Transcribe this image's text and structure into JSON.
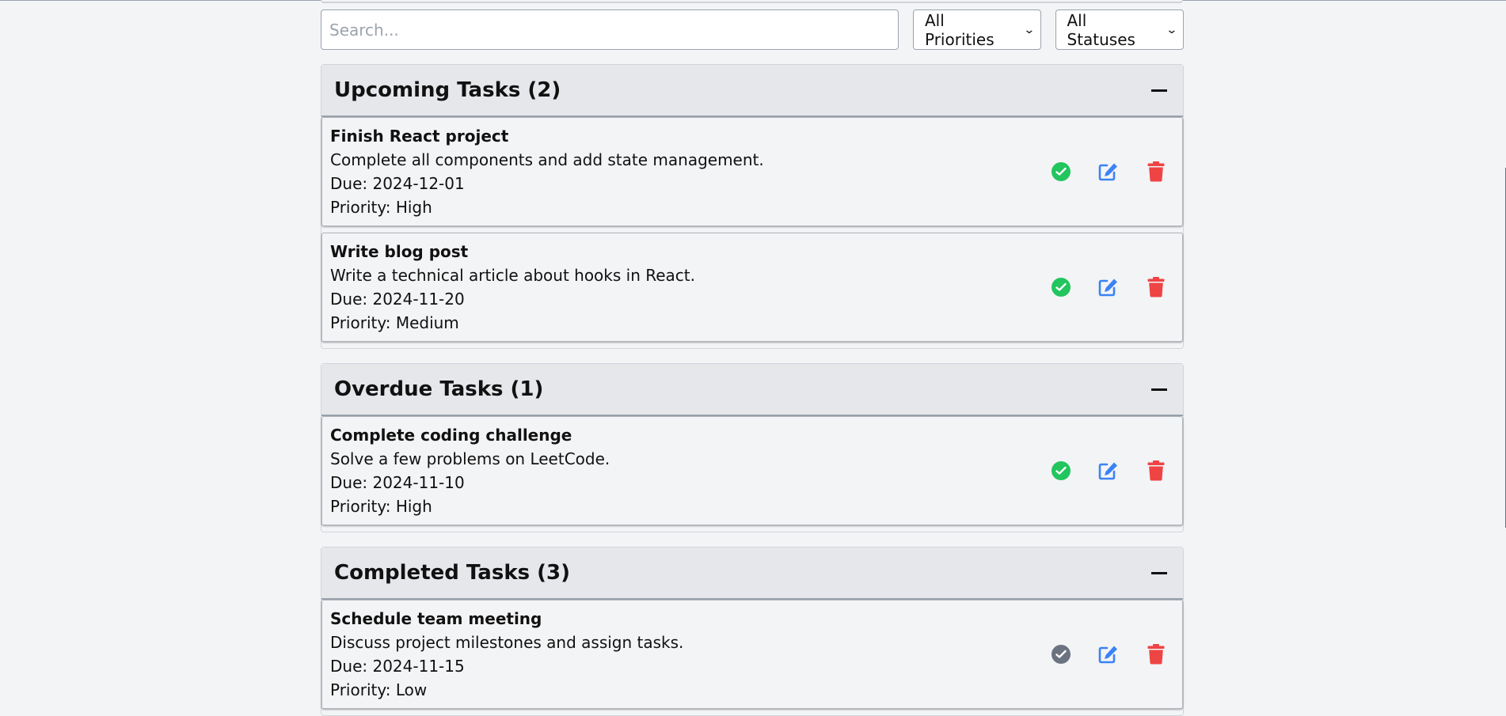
{
  "filters": {
    "search_placeholder": "Search...",
    "priority_selected": "All Priorities",
    "status_selected": "All Statuses"
  },
  "colors": {
    "complete_active": "#22c55e",
    "complete_done": "#6b7280",
    "edit": "#3b82f6",
    "delete": "#ef4444"
  },
  "sections": {
    "upcoming": {
      "title": "Upcoming Tasks (2)",
      "tasks": [
        {
          "title": "Finish React project",
          "description": "Complete all components and add state management.",
          "due": "Due: 2024-12-01",
          "priority": "Priority: High"
        },
        {
          "title": "Write blog post",
          "description": "Write a technical article about hooks in React.",
          "due": "Due: 2024-11-20",
          "priority": "Priority: Medium"
        }
      ]
    },
    "overdue": {
      "title": "Overdue Tasks (1)",
      "tasks": [
        {
          "title": "Complete coding challenge",
          "description": "Solve a few problems on LeetCode.",
          "due": "Due: 2024-11-10",
          "priority": "Priority: High"
        }
      ]
    },
    "completed": {
      "title": "Completed Tasks (3)",
      "tasks": [
        {
          "title": "Schedule team meeting",
          "description": "Discuss project milestones and assign tasks.",
          "due": "Due: 2024-11-15",
          "priority": "Priority: Low"
        }
      ]
    }
  }
}
